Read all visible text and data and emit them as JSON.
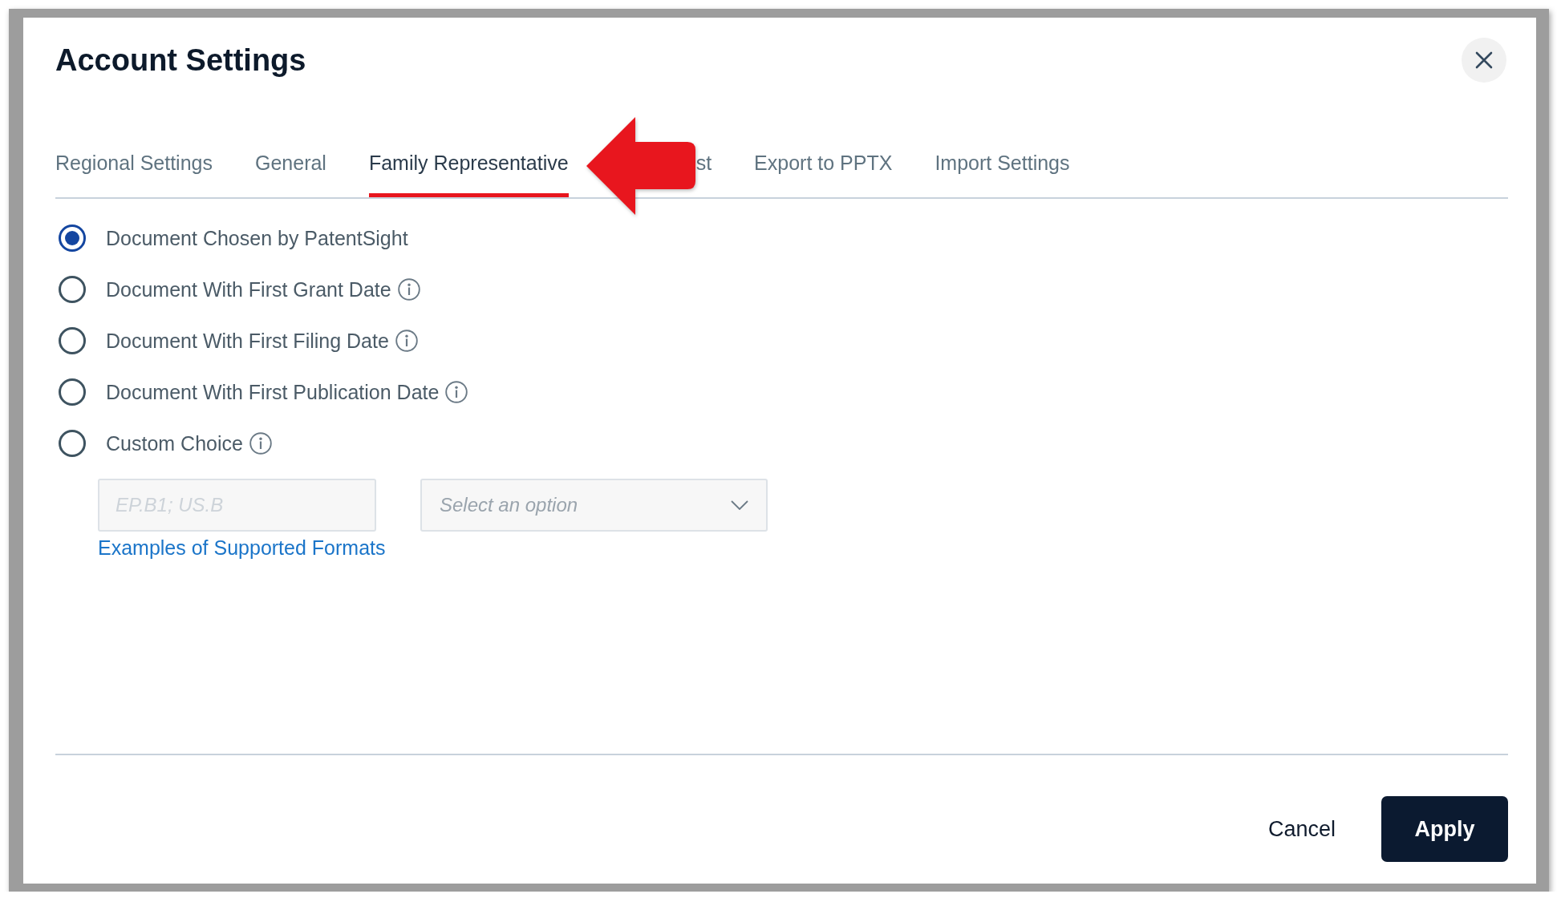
{
  "dialog": {
    "title": "Account Settings"
  },
  "tabs": [
    {
      "label": "Regional Settings",
      "selected": false
    },
    {
      "label": "General",
      "selected": false
    },
    {
      "label": "Family Representative",
      "selected": true
    },
    {
      "label": "st",
      "selected": false
    },
    {
      "label": "Export to PPTX",
      "selected": false
    },
    {
      "label": "Import Settings",
      "selected": false
    }
  ],
  "options": [
    {
      "label": "Document Chosen by PatentSight",
      "selected": true,
      "info": false
    },
    {
      "label": "Document With First Grant Date",
      "selected": false,
      "info": true
    },
    {
      "label": "Document With First Filing Date",
      "selected": false,
      "info": true
    },
    {
      "label": "Document With First Publication Date",
      "selected": false,
      "info": true
    },
    {
      "label": "Custom Choice",
      "selected": false,
      "info": true
    }
  ],
  "custom": {
    "code_field": {
      "placeholder": "EP.B1; US.B"
    },
    "select": {
      "placeholder": "Select an option"
    },
    "link": "Examples of Supported Formats"
  },
  "buttons": [
    {
      "label": "Cancel",
      "kind": "secondary"
    },
    {
      "label": "Apply",
      "kind": "primary"
    }
  ]
}
